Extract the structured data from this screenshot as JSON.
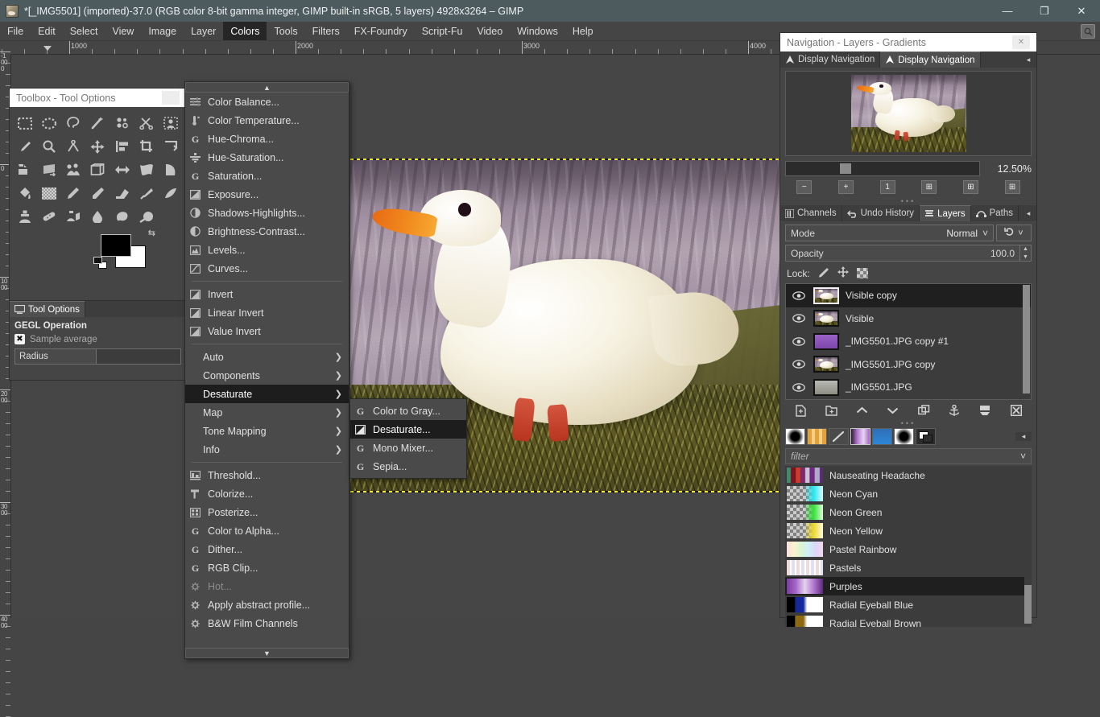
{
  "window": {
    "title": "*[_IMG5501] (imported)-37.0 (RGB color 8-bit gamma integer, GIMP built-in sRGB, 5 layers) 4928x3264 – GIMP",
    "minimize": "—",
    "maximize": "❐",
    "close": "✕",
    "app_icon": "gimp-wilber-icon"
  },
  "menubar": {
    "items": [
      {
        "label": "File"
      },
      {
        "label": "Edit"
      },
      {
        "label": "Select"
      },
      {
        "label": "View"
      },
      {
        "label": "Image"
      },
      {
        "label": "Layer"
      },
      {
        "label": "Colors",
        "active": true
      },
      {
        "label": "Tools"
      },
      {
        "label": "Filters"
      },
      {
        "label": "FX-Foundry"
      },
      {
        "label": "Script-Fu"
      },
      {
        "label": "Video"
      },
      {
        "label": "Windows"
      },
      {
        "label": "Help"
      }
    ],
    "search_icon": "search-icon"
  },
  "rulers": {
    "horizontal_ticks": [
      "1000",
      "2000",
      "3000",
      "4000"
    ],
    "vertical_ticks": [
      "-1000",
      "0",
      "1000",
      "2000",
      "3000",
      "4000"
    ],
    "unit": "px"
  },
  "toolbox": {
    "title": "Toolbox - Tool Options",
    "dock_button": "◂",
    "tools": [
      "rect-select-tool",
      "ellipse-select-tool",
      "free-select-tool",
      "fuzzy-select-tool",
      "select-by-color-tool",
      "scissors-select-tool",
      "foreground-select-tool",
      "color-picker-tool",
      "zoom-tool",
      "measure-tool",
      "move-tool",
      "align-tool",
      "crop-tool",
      "transform-tool",
      "shear-tool",
      "perspective-tool",
      "handle-transform-tool",
      "3d-transform-tool",
      "flip-tool",
      "warp-transform-tool",
      "cage-transform-tool",
      "bucket-fill-tool",
      "gradient-tool",
      "pencil-tool",
      "paintbrush-tool",
      "eraser-tool",
      "airbrush-tool",
      "ink-tool",
      "clone-tool",
      "heal-tool",
      "perspective-clone-tool",
      "blur-sharpen-tool",
      "smudge-tool",
      "dodge-burn-tool"
    ],
    "foreground_color": "#000000",
    "background_color": "#ffffff",
    "swap_icon": "swap-colors-icon",
    "reset_icon": "reset-colors-icon"
  },
  "tool_options": {
    "tab_label": "Tool Options",
    "tab_icon": "tool-options-icon",
    "heading": "GEGL Operation",
    "checkbox_label": "Sample average",
    "checkbox_icon": "checkbox-checked-icon",
    "radius_label": "Radius",
    "radius_value": ""
  },
  "colors_menu": {
    "scroll_up_icon": "chevron-up-icon",
    "scroll_down_icon": "chevron-down-icon",
    "groups": [
      {
        "items": [
          {
            "label": "Color Balance...",
            "icon": "color-balance-icon"
          },
          {
            "label": "Color Temperature...",
            "icon": "color-temperature-icon"
          },
          {
            "label": "Hue-Chroma...",
            "icon": "gegl-icon"
          },
          {
            "label": "Hue-Saturation...",
            "icon": "hue-saturation-icon"
          },
          {
            "label": "Saturation...",
            "icon": "gegl-icon"
          },
          {
            "label": "Exposure...",
            "icon": "exposure-icon"
          },
          {
            "label": "Shadows-Highlights...",
            "icon": "shadows-highlights-icon"
          },
          {
            "label": "Brightness-Contrast...",
            "icon": "brightness-contrast-icon"
          },
          {
            "label": "Levels...",
            "icon": "levels-icon"
          },
          {
            "label": "Curves...",
            "icon": "curves-icon"
          }
        ]
      },
      {
        "items": [
          {
            "label": "Invert",
            "icon": "invert-icon"
          },
          {
            "label": "Linear Invert",
            "icon": "invert-icon"
          },
          {
            "label": "Value Invert",
            "icon": "invert-icon"
          }
        ]
      },
      {
        "items": [
          {
            "label": "Auto",
            "submenu": true
          },
          {
            "label": "Components",
            "submenu": true
          },
          {
            "label": "Desaturate",
            "submenu": true,
            "highlighted": true
          },
          {
            "label": "Map",
            "submenu": true
          },
          {
            "label": "Tone Mapping",
            "submenu": true
          },
          {
            "label": "Info",
            "submenu": true
          }
        ]
      },
      {
        "items": [
          {
            "label": "Threshold...",
            "icon": "threshold-icon"
          },
          {
            "label": "Colorize...",
            "icon": "colorize-icon"
          },
          {
            "label": "Posterize...",
            "icon": "posterize-icon"
          },
          {
            "label": "Color to Alpha...",
            "icon": "gegl-icon"
          },
          {
            "label": "Dither...",
            "icon": "gegl-icon"
          },
          {
            "label": "RGB Clip...",
            "icon": "gegl-icon"
          },
          {
            "label": "Hot...",
            "icon": "script-fu-icon",
            "disabled": true
          },
          {
            "label": "Apply abstract profile...",
            "icon": "script-fu-icon"
          },
          {
            "label": "B&W Film Channels",
            "icon": "script-fu-icon"
          }
        ]
      }
    ]
  },
  "desaturate_submenu": {
    "items": [
      {
        "label": "Color to Gray...",
        "icon": "gegl-icon"
      },
      {
        "label": "Desaturate...",
        "icon": "desaturate-icon",
        "highlighted": true
      },
      {
        "label": "Mono Mixer...",
        "icon": "gegl-icon"
      },
      {
        "label": "Sepia...",
        "icon": "gegl-icon"
      }
    ]
  },
  "right_dock": {
    "title": "Navigation - Layers - Gradients",
    "close_button": "✕",
    "navigation": {
      "tabs": [
        {
          "label": "Display Navigation",
          "icon": "navigation-icon",
          "selected": false
        },
        {
          "label": "Display Navigation",
          "icon": "navigation-icon",
          "selected": true
        }
      ],
      "panel_menu_icon": "panel-menu-icon",
      "zoom_value": "12.50%",
      "buttons": [
        {
          "name": "zoom-out-button",
          "glyph": "−"
        },
        {
          "name": "zoom-in-button",
          "glyph": "+"
        },
        {
          "name": "zoom-1-1-button",
          "glyph": "1"
        },
        {
          "name": "fit-image-in-window-button",
          "glyph": "⊞"
        },
        {
          "name": "fill-window-button",
          "glyph": "⊞"
        },
        {
          "name": "zoom-selection-button",
          "glyph": "⊞"
        }
      ]
    },
    "layers": {
      "tabs": [
        {
          "label": "Channels",
          "icon": "channels-icon",
          "selected": false
        },
        {
          "label": "Undo History",
          "icon": "undo-history-icon",
          "selected": false
        },
        {
          "label": "Layers",
          "icon": "layers-icon",
          "selected": true
        },
        {
          "label": "Paths",
          "icon": "paths-icon",
          "selected": false
        }
      ],
      "panel_menu_icon": "panel-menu-icon",
      "mode_label": "Mode",
      "mode_value": "Normal",
      "mode_dropdown_icon": "chevron-down-icon",
      "switch_icon": "layer-mode-switch-icon",
      "opacity_label": "Opacity",
      "opacity_value": "100.0",
      "lock_label": "Lock:",
      "lock_icons": [
        "lock-pixels-icon",
        "lock-position-icon",
        "lock-alpha-icon"
      ],
      "rows": [
        {
          "name": "Visible copy",
          "visible": true,
          "selected": true,
          "thumb": "duck-thumb-normal"
        },
        {
          "name": "Visible",
          "visible": true,
          "selected": false,
          "thumb": "duck-thumb-normal"
        },
        {
          "name": "_IMG5501.JPG copy #1",
          "visible": true,
          "selected": false,
          "thumb": "duck-thumb-purple"
        },
        {
          "name": "_IMG5501.JPG copy",
          "visible": true,
          "selected": false,
          "thumb": "duck-thumb-warm"
        },
        {
          "name": "_IMG5501.JPG",
          "visible": true,
          "selected": false,
          "thumb": "duck-thumb-gray"
        }
      ],
      "buttons": [
        {
          "name": "new-layer-button",
          "icon": "new-layer-icon"
        },
        {
          "name": "new-layer-group-button",
          "icon": "new-layer-group-icon"
        },
        {
          "name": "raise-layer-button",
          "icon": "chevron-up-icon"
        },
        {
          "name": "lower-layer-button",
          "icon": "chevron-down-icon"
        },
        {
          "name": "duplicate-layer-button",
          "icon": "duplicate-layer-icon"
        },
        {
          "name": "anchor-layer-button",
          "icon": "anchor-icon"
        },
        {
          "name": "merge-down-button",
          "icon": "merge-down-icon"
        },
        {
          "name": "delete-layer-button",
          "icon": "delete-layer-icon"
        }
      ]
    },
    "gradients": {
      "tabs": [
        {
          "name": "brushes-tab",
          "icon": "brushes-icon",
          "selected": false
        },
        {
          "name": "patterns-tab",
          "icon": "patterns-icon",
          "selected": false
        },
        {
          "name": "dynamics-tab",
          "icon": "dynamics-icon",
          "selected": false
        },
        {
          "name": "gradients-tab",
          "icon": "gradients-icon",
          "selected": true
        },
        {
          "name": "palettes-tab",
          "icon": "palettes-icon",
          "selected": false
        },
        {
          "name": "fonts-tab",
          "icon": "fonts-icon",
          "selected": false
        },
        {
          "name": "document-history-tab",
          "icon": "document-history-icon",
          "selected": false
        }
      ],
      "panel_menu_icon": "panel-menu-icon",
      "filter_placeholder": "filter",
      "filter_dropdown_icon": "chevron-down-icon",
      "items": [
        {
          "name": "Nauseating Headache",
          "selected": false,
          "swatch": "nauseating-headache"
        },
        {
          "name": "Neon Cyan",
          "selected": false,
          "swatch": "neon-cyan"
        },
        {
          "name": "Neon Green",
          "selected": false,
          "swatch": "neon-green"
        },
        {
          "name": "Neon Yellow",
          "selected": false,
          "swatch": "neon-yellow"
        },
        {
          "name": "Pastel Rainbow",
          "selected": false,
          "swatch": "pastel-rainbow"
        },
        {
          "name": "Pastels",
          "selected": false,
          "swatch": "pastels"
        },
        {
          "name": "Purples",
          "selected": true,
          "swatch": "purples"
        },
        {
          "name": "Radial Eyeball Blue",
          "selected": false,
          "swatch": "radial-eyeball-blue"
        },
        {
          "name": "Radial Eyeball Brown",
          "selected": false,
          "swatch": "radial-eyeball-brown"
        }
      ]
    }
  },
  "colors": {
    "accent_highlight": "#1d1d1d",
    "panel_bg": "#454545",
    "menu_bg": "#4a4a4a",
    "titlebar_bg": "#4d5b5e",
    "text": "#e0e0e0",
    "selection_marching_ants": "#f6f000"
  }
}
